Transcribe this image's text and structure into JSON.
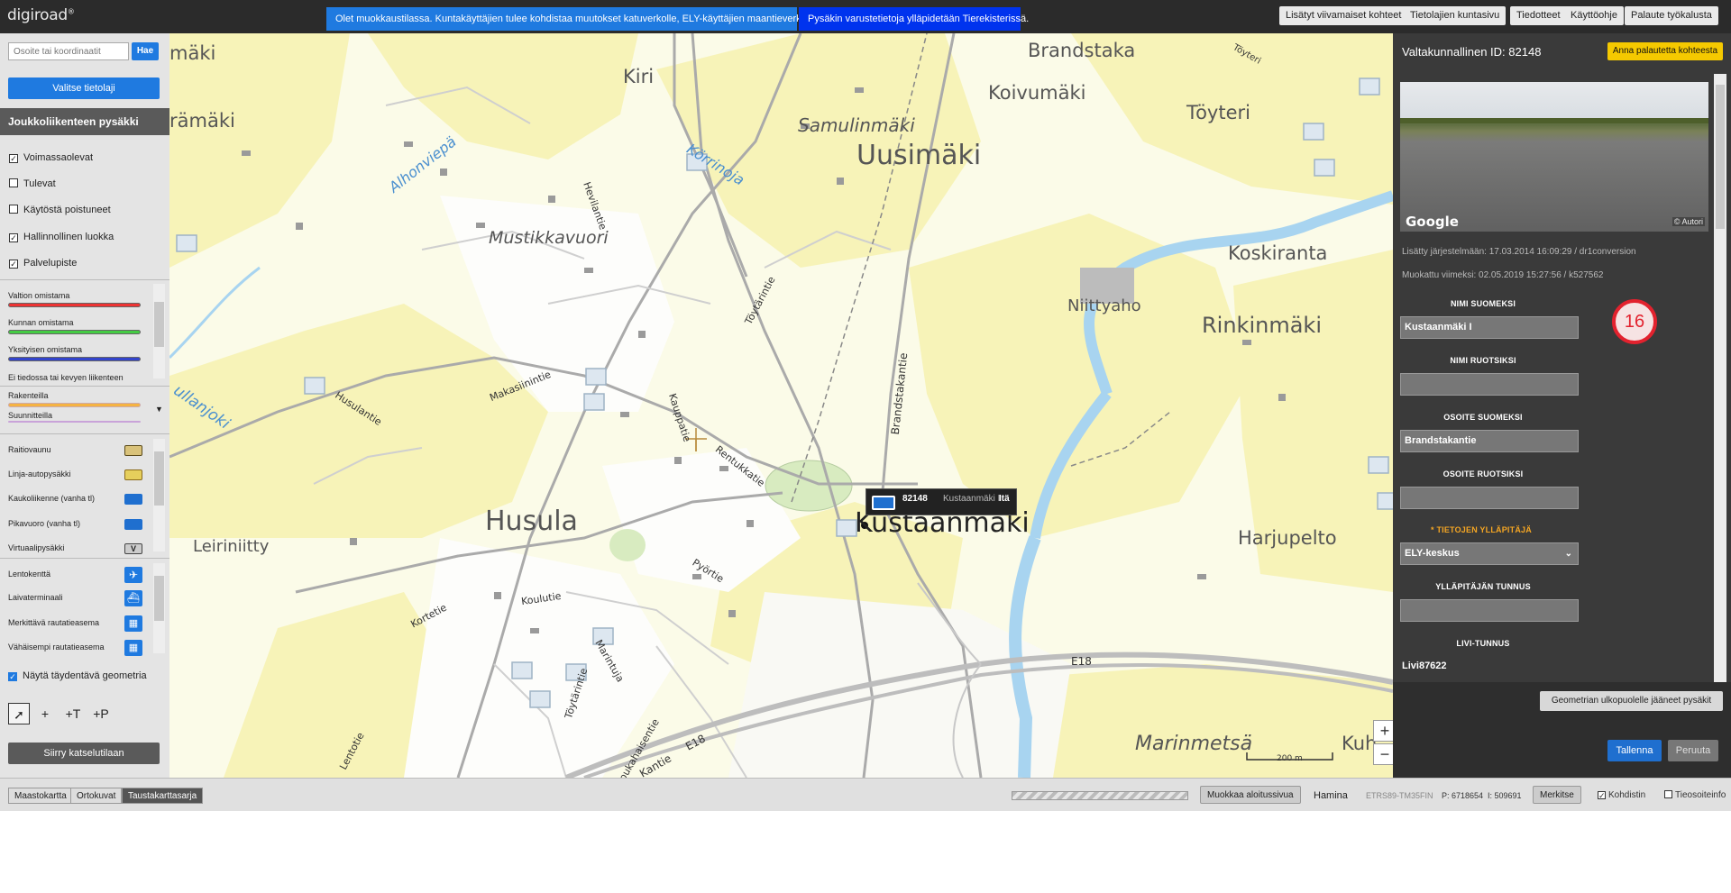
{
  "app": {
    "logo": "digiroad",
    "logo_mark": "®"
  },
  "notices": {
    "edit_mode": "Olet muokkaustilassa. Kuntakäyttäjien tulee kohdistaa muutokset katuverkolle, ELY-käyttäjien maantieverkolle.",
    "equipment_info": "Pysäkin varustetietoja ylläpidetään Tierekisterissä."
  },
  "top_menu": [
    "Lisätyt viivamaiset kohteet",
    "Tietolajien kuntasivu",
    "Tiedotteet",
    "Käyttöohje",
    "Palaute työkalusta"
  ],
  "left": {
    "search_placeholder": "Osoite tai koordinaatit",
    "search_button": "Hae",
    "select_layer_button": "Valitse tietolaji",
    "layer_title": "Joukkoliikenteen pysäkki",
    "filters": [
      {
        "label": "Voimassaolevat",
        "checked": true
      },
      {
        "label": "Tulevat",
        "checked": false
      },
      {
        "label": "Käytöstä poistuneet",
        "checked": false
      },
      {
        "label": "Hallinnollinen luokka",
        "checked": true
      },
      {
        "label": "Palvelupiste",
        "checked": true
      }
    ],
    "ownership_legend": [
      {
        "label": "Valtion omistama",
        "color": "#ee3333"
      },
      {
        "label": "Kunnan omistama",
        "color": "#44cc44"
      },
      {
        "label": "Yksityisen omistama",
        "color": "#3344cc"
      },
      {
        "label": "Ei tiedossa tai kevyen liikenteen",
        "color": ""
      }
    ],
    "status_legend": [
      {
        "label": "Rakenteilla",
        "color": "#f5b342"
      },
      {
        "label": "Suunnitteilla",
        "color": "#c9a3d9"
      }
    ],
    "stop_types": [
      {
        "label": "Raitiovaunu",
        "color": "#5a4a1a"
      },
      {
        "label": "Linja-autopysäkki",
        "color": "#d6b52a"
      },
      {
        "label": "Kaukoliikenne (vanha tl)",
        "color": "#1f6fcf"
      },
      {
        "label": "Pikavuoro (vanha tl)",
        "color": "#1f6fcf"
      },
      {
        "label": "Virtuaalipysäkki",
        "color": "#444444"
      }
    ],
    "service_points": [
      {
        "label": "Lentokenttä",
        "color": "#1f7ae0"
      },
      {
        "label": "Laivaterminaali",
        "color": "#1f7ae0"
      },
      {
        "label": "Merkittävä rautatieasema",
        "color": "#1f7ae0"
      },
      {
        "label": "Vähäisempi rautatieasema",
        "color": "#1f7ae0"
      }
    ],
    "geometry_checkbox": "Näytä täydentävä geometria",
    "tools": [
      "+",
      "+T",
      "+P"
    ],
    "view_mode_button": "Siirry katselutilaan"
  },
  "map": {
    "labels_big": [
      "Uusimäki",
      "Husula",
      "Kustaanmäki"
    ],
    "labels_medium": [
      "Brandstaka",
      "Koivumäki",
      "Töyteri",
      "Kiri",
      "Koskiranta",
      "Rinkinmäki",
      "Niittyaho",
      "Harjupelto",
      "Leiriniitty",
      "Samulinmäki",
      "Mustikkavuori",
      "Marinmetsä",
      "rämäki",
      "mäki",
      "Kuh"
    ],
    "labels_water": [
      "Alhonviepä",
      "Körrinoja",
      "ullanjoki"
    ],
    "labels_roads": [
      "Hevilantie",
      "Töytärintie",
      "Makasiinintie",
      "Husulantie",
      "Kauppatie",
      "Brandstakantie",
      "Rentukkatie",
      "Pyörtie",
      "Koulutie",
      "Kortetie",
      "Marintuja",
      "Töytärintie",
      "Joukahaisentie",
      "Lentotie",
      "E18",
      "E18",
      "Kantie",
      "Töyteri"
    ],
    "popup": {
      "id": "82148",
      "name": "Kustaanmäki I",
      "direction": "Itä"
    },
    "scale": "200 m",
    "zoom_in": "+",
    "zoom_out": "−"
  },
  "right": {
    "title": "Valtakunnallinen ID: 82148",
    "feedback_button": "Anna palautetta kohteesta",
    "streetview_brand": "Google",
    "streetview_credit": "© Autori",
    "added": "Lisätty järjestelmään: 17.03.2014 16:09:29 / dr1conversion",
    "modified": "Muokattu viimeksi: 02.05.2019 15:27:56 / k527562",
    "fields": [
      {
        "label": "NIMI SUOMEKSI",
        "value": ""
      },
      {
        "label": "NIMI RUOTSIKSI",
        "value": ""
      },
      {
        "label": "OSOITE SUOMEKSI",
        "value": "Brandstakantie"
      },
      {
        "label": "OSOITE RUOTSIKSI",
        "value": ""
      }
    ],
    "name_fi": "Kustaanmäki I",
    "maintainer_label": "* TIETOJEN YLLÄPITÄJÄ",
    "maintainer_value": "ELY-keskus",
    "maintainer_id_label": "YLLÄPITÄJÄN TUNNUS",
    "livi_label": "LIVI-TUNNUS",
    "livi_value": "Livi87622",
    "badge": "16",
    "outside_button": "Geometrian ulkopuolelle jääneet pysäkit",
    "save_button": "Tallenna",
    "cancel_button": "Peruuta"
  },
  "bottom": {
    "bg_tabs": [
      "Maastokartta",
      "Ortokuvat",
      "Taustakarttasarja"
    ],
    "edit_start_button": "Muokkaa aloitussivua",
    "municipality": "Hamina",
    "coord_system": "ETRS89-TM35FIN",
    "coord_p": "P: 6718654",
    "coord_i": "I: 509691",
    "mark_button": "Merkitse",
    "target_label": "Kohdistin",
    "road_address_label": "Tieosoiteinfo"
  }
}
